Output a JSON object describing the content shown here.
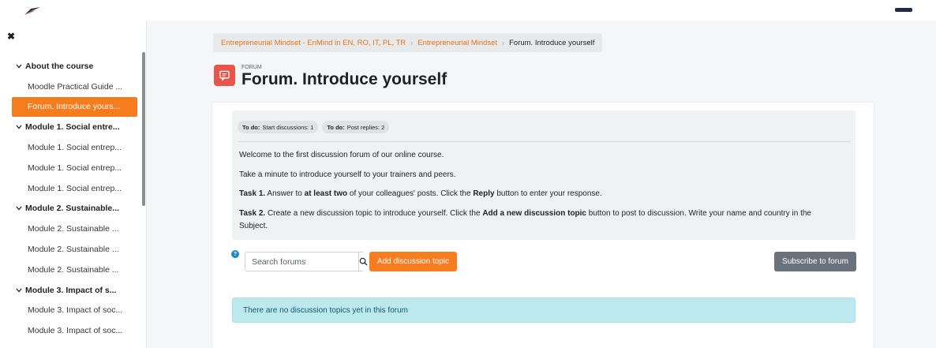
{
  "drawer": {
    "close_glyph": "✖",
    "course_index": [
      {
        "type": "section",
        "label": "About the course"
      },
      {
        "type": "activity",
        "label": "Moodle Practical Guide ..."
      },
      {
        "type": "activity",
        "label": "Forum. Introduce yours...",
        "active": true
      },
      {
        "type": "section",
        "label": "Module 1. Social entre..."
      },
      {
        "type": "activity",
        "label": "Module 1. Social entrep..."
      },
      {
        "type": "activity",
        "label": "Module 1. Social entrep..."
      },
      {
        "type": "activity",
        "label": "Module 1. Social entrep..."
      },
      {
        "type": "section",
        "label": "Module 2. Sustainable..."
      },
      {
        "type": "activity",
        "label": "Module 2. Sustainable ..."
      },
      {
        "type": "activity",
        "label": "Module 2. Sustainable ..."
      },
      {
        "type": "activity",
        "label": "Module 2. Sustainable ..."
      },
      {
        "type": "section",
        "label": "Module 3. Impact of s..."
      },
      {
        "type": "activity",
        "label": "Module 3. Impact of soc..."
      },
      {
        "type": "activity",
        "label": "Module 3. Impact of soc..."
      }
    ]
  },
  "breadcrumb": {
    "items": [
      "Entrepreneurial Mindset - EnMind in EN, RO, IT, PL, TR",
      "Entrepreneurial Mindset"
    ],
    "separator": "›",
    "current": "Forum. Introduce yourself"
  },
  "header": {
    "kicker": "FORUM",
    "title": "Forum. Introduce yourself"
  },
  "todo": [
    {
      "prefix": "To do:",
      "text": "Start discussions: 1"
    },
    {
      "prefix": "To do:",
      "text": "Post replies: 2"
    }
  ],
  "intro": {
    "line1": "Welcome to the first discussion forum of our online course.",
    "line2": "Take a minute to introduce yourself to your trainers and peers.",
    "task1": {
      "label": "Task 1.",
      "t1": " Answer to ",
      "b1": "at least two",
      "t2": " of your colleagues' posts. Click the ",
      "b2": "Reply",
      "t3": " button to enter your response."
    },
    "task2": {
      "label": "Task 2.",
      "t1": " Create a new discussion topic to introduce yourself. Click the ",
      "b1": "Add a new discussion topic",
      "t2": " button to post to discussion. Write your name and country in the",
      "t3": "Subject."
    }
  },
  "controls": {
    "help_glyph": "?",
    "search_placeholder": "Search forums",
    "add_topic_label": "Add discussion topic",
    "subscribe_label": "Subscribe to forum"
  },
  "alert": {
    "text": "There are no discussion topics yet in this forum"
  },
  "colors": {
    "accent": "#f57c1f",
    "forum_icon": "#e8534a",
    "info_alert": "#bde8ee"
  },
  "icons": [
    "logo-icon",
    "close-icon",
    "chevron-down-icon",
    "forum-icon",
    "help-icon",
    "search-icon"
  ]
}
